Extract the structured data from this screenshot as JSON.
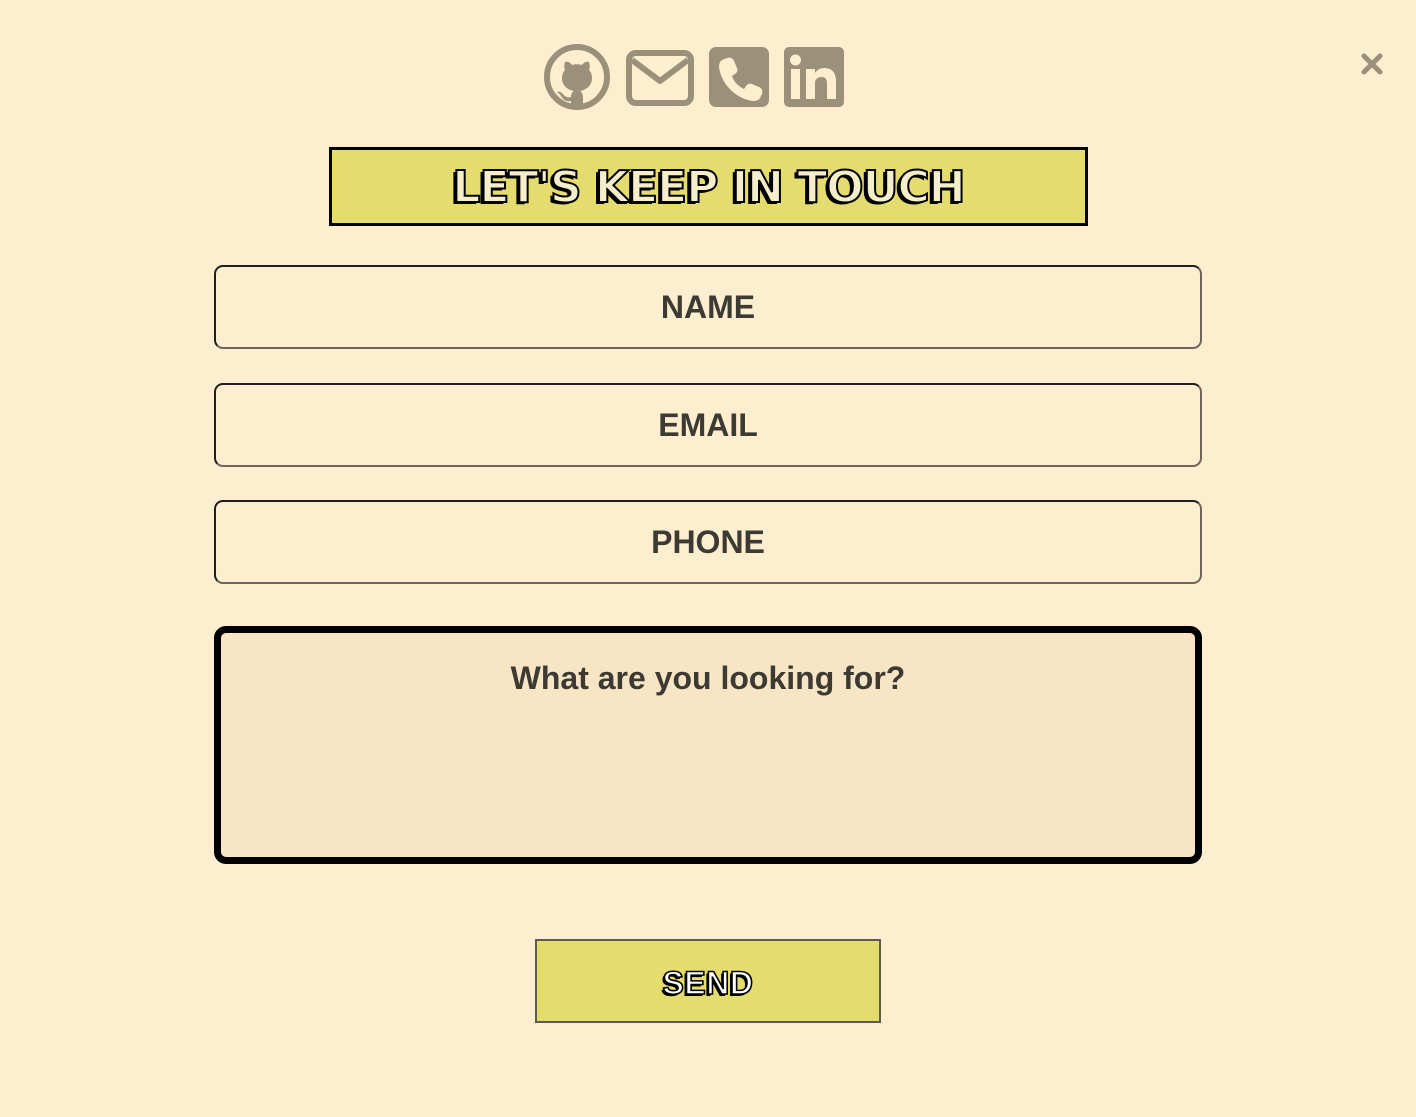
{
  "close": {
    "icon": "close-icon",
    "color": "#9b9079"
  },
  "social": [
    {
      "icon": "github-icon",
      "label": "GitHub"
    },
    {
      "icon": "mail-icon",
      "label": "Email"
    },
    {
      "icon": "phone-icon",
      "label": "Phone"
    },
    {
      "icon": "linkedin-icon",
      "label": "LinkedIn"
    }
  ],
  "icon_color": "#9b9079",
  "heading": {
    "text": "LET'S KEEP IN TOUCH",
    "background": "#e5dc6f"
  },
  "form": {
    "name_placeholder": "NAME",
    "email_placeholder": "EMAIL",
    "phone_placeholder": "PHONE",
    "message_placeholder": "What are you looking for?",
    "send_label": "SEND"
  },
  "colors": {
    "page_background": "#fdeecf",
    "textarea_background": "#f7e5c5",
    "button_background": "#e5dc6f",
    "text": "#3d3a33"
  }
}
